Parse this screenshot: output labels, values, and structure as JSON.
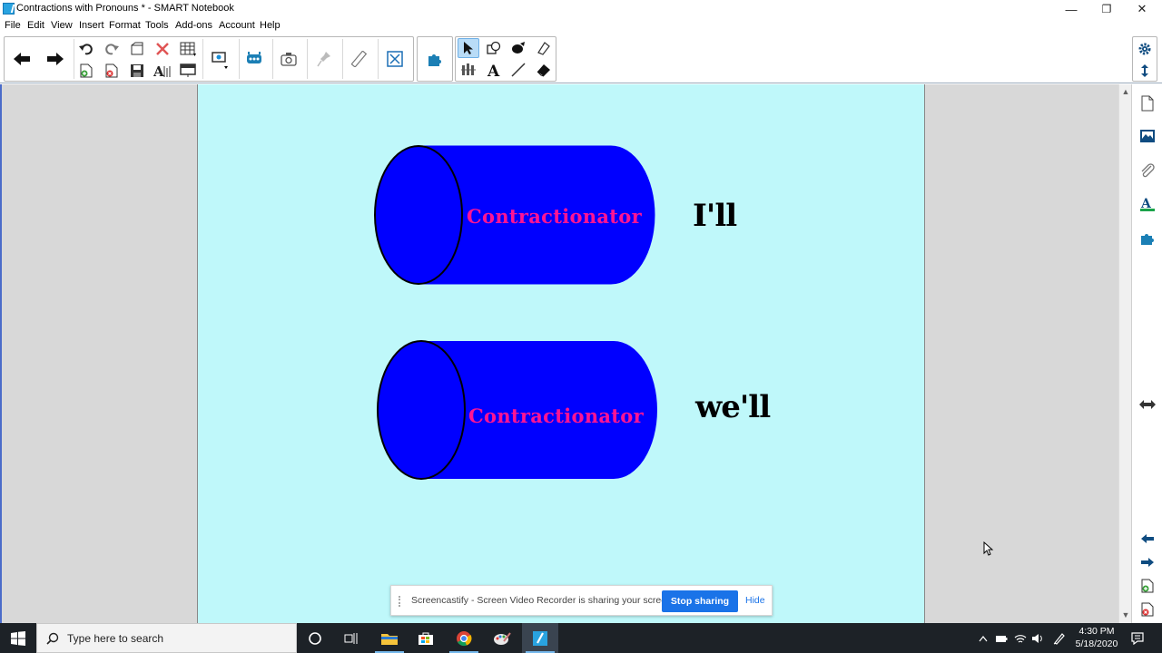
{
  "window": {
    "title": "Contractions with Pronouns * - SMART Notebook",
    "controls": [
      "—",
      "❐",
      "✕"
    ]
  },
  "menu": [
    "File",
    "Edit",
    "View",
    "Insert",
    "Format",
    "Tools",
    "Add-ons",
    "Account",
    "Help"
  ],
  "page": {
    "background": "#bff8fa",
    "cylinders": [
      {
        "label": "Contractionator",
        "word": "I'll"
      },
      {
        "label": "Contractionator",
        "word": "we'll"
      }
    ],
    "cylinder_color": "#0000ff",
    "label_color": "#ff1493"
  },
  "share_banner": {
    "text": "Screencastify - Screen Video Recorder is sharing your screen.",
    "stop_label": "Stop sharing",
    "hide_label": "Hide"
  },
  "taskbar": {
    "search_placeholder": "Type here to search",
    "time": "4:30 PM",
    "date": "5/18/2020"
  },
  "icons": {
    "toolbar": [
      "back-arrow-icon",
      "forward-arrow-icon",
      "undo-icon",
      "redo-icon",
      "open-file-icon",
      "delete-icon",
      "table-icon",
      "add-page-icon",
      "delete-page-icon",
      "save-icon",
      "spell-check-icon",
      "screen-shade-icon",
      "display-icon",
      "response-icon",
      "screen-capture-icon",
      "pin-icon",
      "measure-icon",
      "fullscreen-icon",
      "addons-icon",
      "select-icon",
      "shapes-icon",
      "fill-icon",
      "pen-icon",
      "creative-pen-icon",
      "text-icon",
      "line-icon",
      "eraser-icon",
      "settings-icon",
      "toolbar-position-icon"
    ],
    "sidebar": [
      "page-sorter-icon",
      "gallery-icon",
      "attachments-icon",
      "properties-icon",
      "addons-icon",
      "move-sidebar-icon",
      "previous-page-icon",
      "next-page-icon",
      "add-page-icon",
      "delete-page-icon"
    ]
  }
}
